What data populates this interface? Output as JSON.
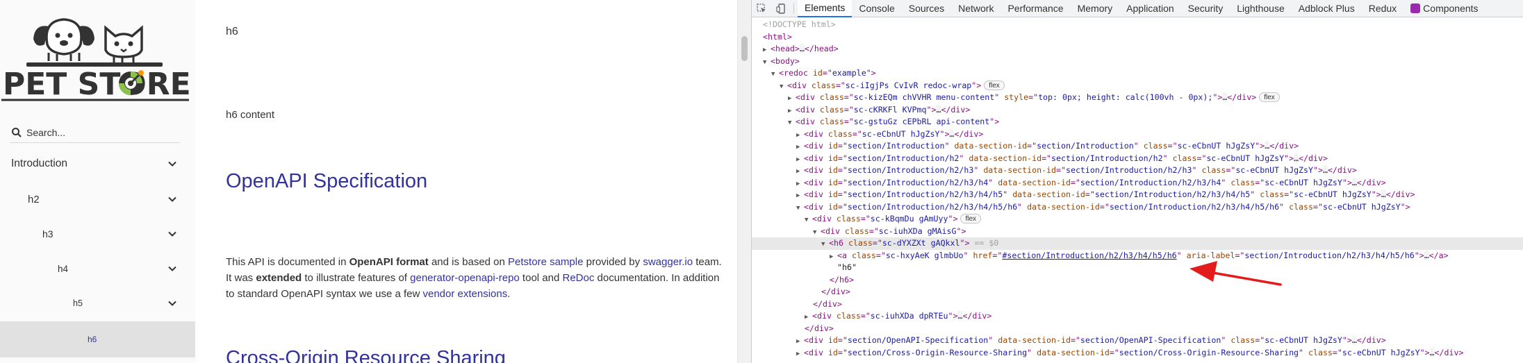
{
  "sidebar": {
    "logo_text": "PET STORE",
    "search": {
      "placeholder": "Search..."
    },
    "nav": [
      {
        "label": "Introduction"
      },
      {
        "label": "h2"
      },
      {
        "label": "h3"
      },
      {
        "label": "h4"
      },
      {
        "label": "h5"
      },
      {
        "label": "h6"
      }
    ],
    "active_color": "#32329f"
  },
  "content": {
    "h6_heading": "h6",
    "h6_body": "h6 content",
    "openapi_title": "OpenAPI Specification",
    "desc": {
      "p1": "This API is documented in ",
      "b1": "OpenAPI format",
      "p2": " and is based on ",
      "l1": "Petstore sample",
      "p3": " provided by ",
      "l2": "swagger.io",
      "p4": " team. It was ",
      "b2": "extended",
      "p5": " to illustrate features of ",
      "l3": "generator-openapi-repo",
      "p6": " tool and ",
      "l4": "ReDoc",
      "p7": " documentation. In addition to standard OpenAPI syntax we use a few ",
      "l5": "vendor extensions",
      "p8": "."
    },
    "cors_title": "Cross-Origin Resource Sharing",
    "link_color": "#32329f"
  },
  "devtools": {
    "tabs": [
      "Elements",
      "Console",
      "Sources",
      "Network",
      "Performance",
      "Memory",
      "Application",
      "Security",
      "Lighthouse",
      "Adblock Plus",
      "Redux",
      "Components"
    ],
    "active_tab": "Elements",
    "badge_flex": "flex",
    "dollar_zero": "== $0",
    "ellipsis": "…",
    "dom": {
      "doctype": "<!DOCTYPE html>",
      "html": "html",
      "head": "head",
      "body": "body",
      "redoc": "redoc",
      "div": "div",
      "h6": "h6",
      "a": "a",
      "id": "id",
      "class": "class",
      "style": "style",
      "data_section_id": "data-section-id",
      "href": "href",
      "aria_label": "aria-label",
      "redoc_id": "example",
      "wrap_class": "sc-iIgjPs CvIvR redoc-wrap",
      "menu_class": "sc-kizEQm chVVHR menu-content",
      "menu_style": "top: 0px; height: calc(100vh - 0px);",
      "kv_class": "sc-cKRKFl KVPmq",
      "api_class": "sc-gstuGz cEPbRL api-content",
      "sec_class": "sc-eCbnUT hJgZsY",
      "sec_intro": "section/Introduction",
      "sec_h2": "section/Introduction/h2",
      "sec_h3": "section/Introduction/h2/h3",
      "sec_h4": "section/Introduction/h2/h3/h4",
      "sec_h5": "section/Introduction/h2/h3/h4/h5",
      "sec_h6": "section/Introduction/h2/h3/h4/h5/h6",
      "kb_class": "sc-kBqmDu gAmUyy",
      "iu_class": "sc-iuhXDa gMAisG",
      "h6_class": "sc-dYXZXt gAQkxl",
      "a_class": "sc-hxyAeK glmbUo",
      "a_href": "#section/Introduction/h2/h3/h4/h5/h6",
      "text_h6": "\"h6\"",
      "iu2_class": "sc-iuhXDa dpRTEu",
      "sec_openapi": "section/OpenAPI-Specification",
      "sec_cors": "section/Cross-Origin-Resource-Sharing"
    }
  }
}
